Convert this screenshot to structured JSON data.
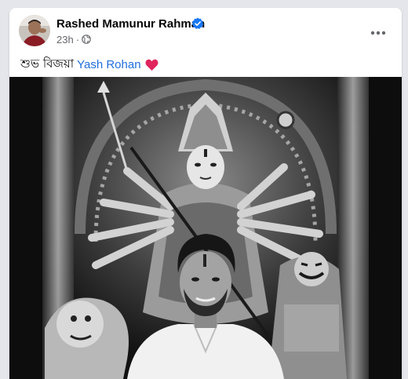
{
  "post": {
    "author": "Rashed Mamunur Rahman",
    "timestamp": "23h",
    "separator": "·",
    "text": "শুভ বিজয়া",
    "tag": "Yash Rohan"
  },
  "icons": {
    "verified": "verified-badge-icon",
    "privacy": "globe-icon",
    "more": "more-options-icon",
    "emoji": "red-heart-icon"
  },
  "colors": {
    "link": "#216fdb",
    "verified": "#1877f2",
    "heart": "#e0245e",
    "secondary_text": "#65676b"
  }
}
